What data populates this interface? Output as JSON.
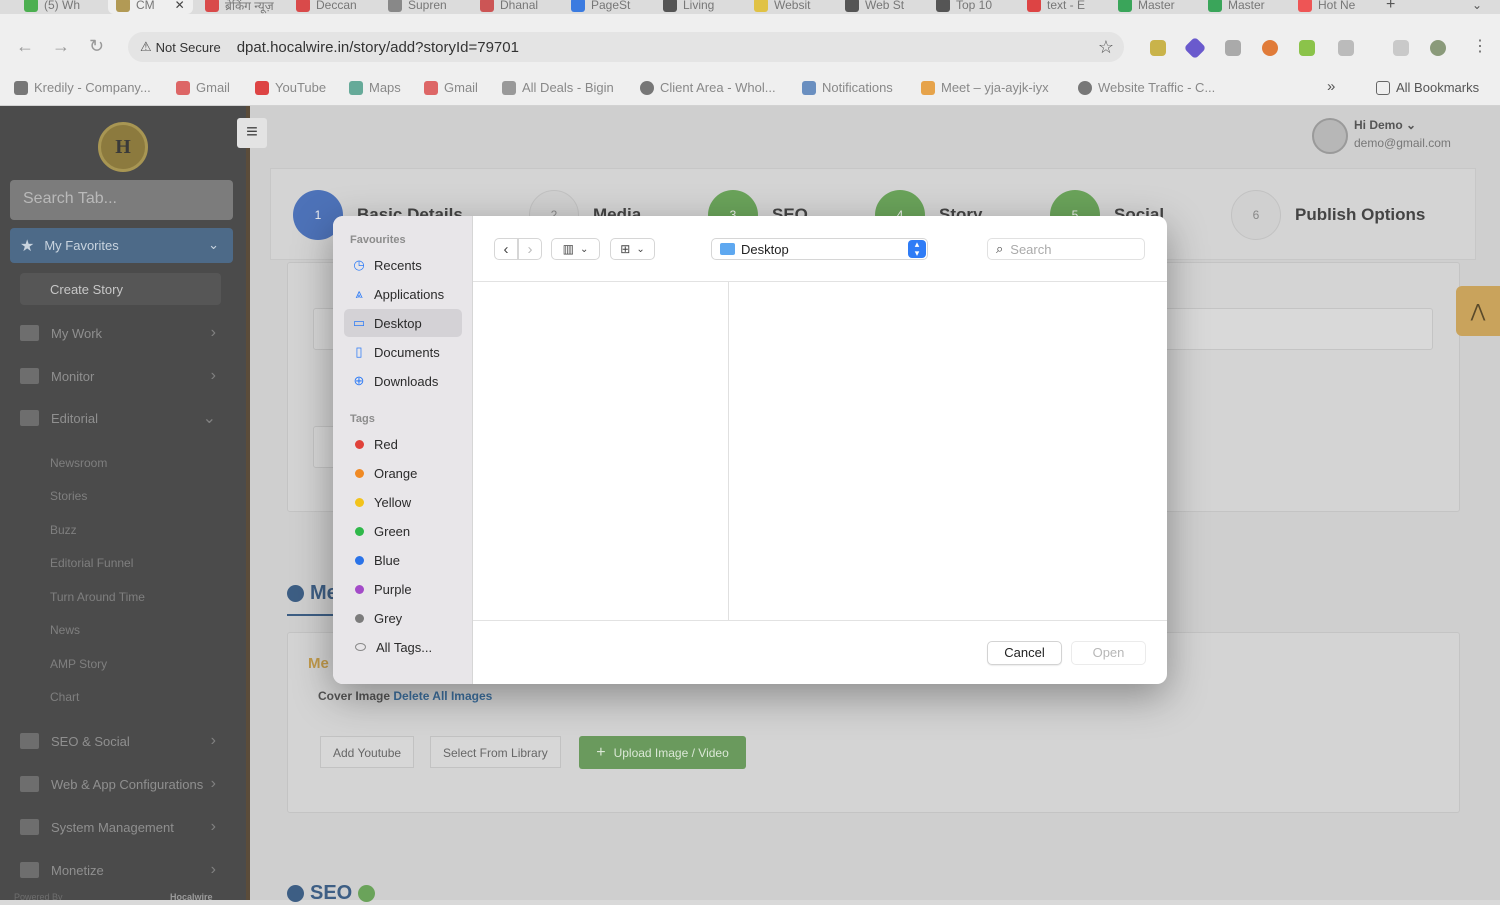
{
  "browser": {
    "tabs": [
      "(5) Wh",
      "CM",
      "ब्रेकिंग न्यूज़",
      "Deccan",
      "Supren",
      "Dhanal",
      "PageSt",
      "Living",
      "Websit",
      "Web St",
      "Top 10",
      "text - E",
      "Master",
      "Master",
      "Hot Ne"
    ],
    "security_label": "Not Secure",
    "url": "dpat.hocalwire.in/story/add?storyId=79701",
    "bookmarks": [
      "Kredily - Company...",
      "Gmail",
      "YouTube",
      "Maps",
      "Gmail",
      "All Deals - Bigin",
      "Client Area - Whol...",
      "Notifications",
      "Meet – yja-ayjk-iyx",
      "Website Traffic - C..."
    ],
    "all_bookmarks": "All Bookmarks",
    "overflow": "»"
  },
  "sidebar": {
    "search_placeholder": "Search Tab...",
    "favorites_label": "My Favorites",
    "create_story": "Create Story",
    "menu": [
      "My Work",
      "Monitor",
      "Editorial"
    ],
    "editorial_items": [
      "Newsroom",
      "Stories",
      "Buzz",
      "Editorial Funnel",
      "Turn Around Time",
      "News",
      "AMP Story",
      "Chart"
    ],
    "menu_bottom": [
      "SEO & Social",
      "Web & App Configurations",
      "System Management",
      "Monetize"
    ],
    "powered_by": "Powered By",
    "brand": "Hocalwire"
  },
  "header": {
    "greeting": "Hi Demo",
    "email": "demo@gmail.com"
  },
  "steps": [
    {
      "num": "1",
      "label": "Basic Details",
      "color": "#4d72b8"
    },
    {
      "num": "2",
      "label": "Media",
      "color": "#d0d0d0"
    },
    {
      "num": "3",
      "label": "SEO",
      "color": "#6aa35a"
    },
    {
      "num": "4",
      "label": "Story",
      "color": "#6aa35a"
    },
    {
      "num": "5",
      "label": "Social",
      "color": "#6aa35a"
    },
    {
      "num": "6",
      "label": "Publish Options",
      "color": "#d0d0d0"
    }
  ],
  "form": {
    "section_media": "Me",
    "section_seo": "SEO",
    "media_sub": "Me",
    "cover_image": "Cover Image",
    "delete_all": "Delete All Images",
    "btn_youtube": "Add Youtube",
    "btn_library": "Select From Library",
    "btn_upload": "Upload Image / Video"
  },
  "dialog": {
    "favourites_heading": "Favourites",
    "favourites": [
      {
        "label": "Recents",
        "icon": "clock-icon"
      },
      {
        "label": "Applications",
        "icon": "applications-icon"
      },
      {
        "label": "Desktop",
        "icon": "desktop-icon"
      },
      {
        "label": "Documents",
        "icon": "document-icon"
      },
      {
        "label": "Downloads",
        "icon": "download-icon"
      }
    ],
    "tags_heading": "Tags",
    "tags": [
      {
        "label": "Red",
        "color": "#e0423a"
      },
      {
        "label": "Orange",
        "color": "#f08a24"
      },
      {
        "label": "Yellow",
        "color": "#f2c31b"
      },
      {
        "label": "Green",
        "color": "#2fb84a"
      },
      {
        "label": "Blue",
        "color": "#2a73e8"
      },
      {
        "label": "Purple",
        "color": "#a34bc8"
      },
      {
        "label": "Grey",
        "color": "#7c7c7c"
      }
    ],
    "all_tags": "All Tags...",
    "location": "Desktop",
    "search_placeholder": "Search",
    "cancel": "Cancel",
    "open": "Open"
  }
}
